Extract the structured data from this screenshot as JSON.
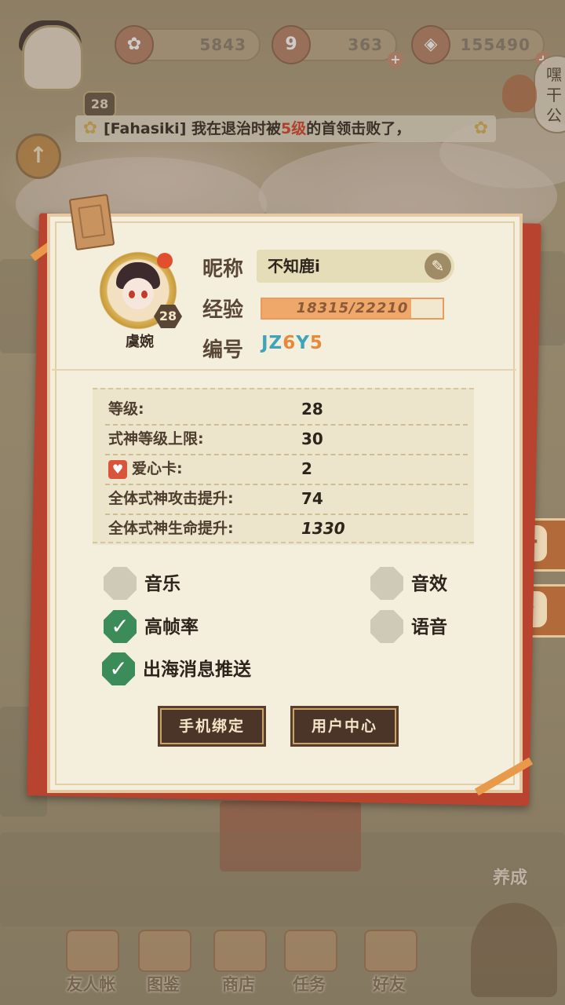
{
  "top_bar": {
    "player_level": "28",
    "resources": [
      {
        "icon": "plum-blossom-icon",
        "value": "5843",
        "symbol": "✿"
      },
      {
        "icon": "magatama-icon",
        "value": "363",
        "symbol": "9"
      },
      {
        "icon": "coin-icon",
        "value": "155490",
        "symbol": "◈"
      }
    ],
    "side_text": "嘿\n干\n公"
  },
  "ticker": {
    "prefix": "[Fahasiki] 我在退治时被",
    "highlight": "5级",
    "suffix": "的首领击败了，"
  },
  "panel": {
    "avatar_level": "28",
    "title": "虞婉",
    "labels": {
      "nickname": "昵称",
      "experience": "经验",
      "id": "编号"
    },
    "nickname": "不知鹿i",
    "experience": {
      "current": 18315,
      "max": 22210,
      "text": "18315/22210"
    },
    "id_parts": [
      "JZ",
      "6",
      "Y",
      "5"
    ],
    "stats": [
      {
        "key": "等级:",
        "value": "28"
      },
      {
        "key": "式神等级上限:",
        "value": "30"
      },
      {
        "key": "爱心卡:",
        "value": "2"
      },
      {
        "key": "全体式神攻击提升:",
        "value": "74"
      },
      {
        "key": "全体式神生命提升:",
        "value": "1330"
      }
    ],
    "options": [
      {
        "label": "音乐",
        "checked": false
      },
      {
        "label": "音效",
        "checked": false
      },
      {
        "label": "高帧率",
        "checked": true
      },
      {
        "label": "语音",
        "checked": false
      },
      {
        "label": "出海消息推送",
        "checked": true
      }
    ],
    "buttons": {
      "phone_bind": "手机绑定",
      "user_center": "用户中心"
    }
  },
  "side_buttons": [
    {
      "icon": "chat-icon",
      "symbol": "···"
    },
    {
      "icon": "gift-icon",
      "symbol": "✦"
    }
  ],
  "bottom_nav": [
    {
      "label": "友人帐"
    },
    {
      "label": "图鉴"
    },
    {
      "label": "商店"
    },
    {
      "label": "任务"
    },
    {
      "label": "好友"
    }
  ],
  "cultivate_label": "养成"
}
